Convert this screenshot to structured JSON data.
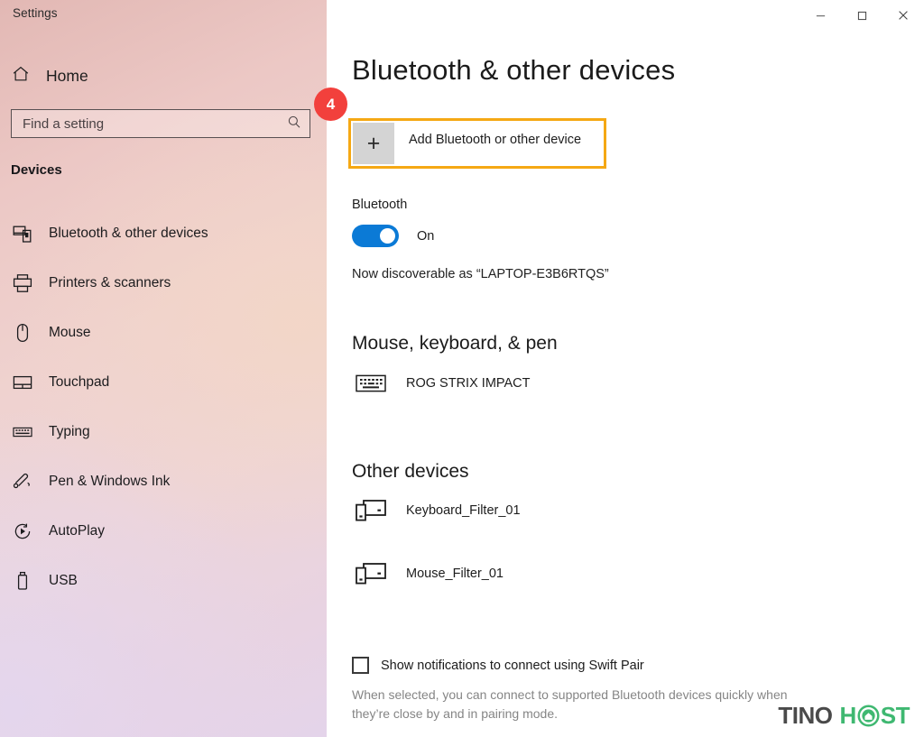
{
  "window": {
    "title": "Settings",
    "controls": [
      {
        "name": "minimize",
        "glyph": "—"
      },
      {
        "name": "maximize",
        "glyph": "□"
      },
      {
        "name": "close",
        "glyph": "✕"
      }
    ]
  },
  "sidebar": {
    "home_label": "Home",
    "search": {
      "placeholder": "Find a setting",
      "value": "",
      "icon": "search-icon"
    },
    "section_header": "Devices",
    "items": [
      {
        "label": "Bluetooth & other devices",
        "icon": "bluetooth-devices-icon",
        "selected": true
      },
      {
        "label": "Printers & scanners",
        "icon": "printer-icon",
        "selected": false
      },
      {
        "label": "Mouse",
        "icon": "mouse-icon",
        "selected": false
      },
      {
        "label": "Touchpad",
        "icon": "touchpad-icon",
        "selected": false
      },
      {
        "label": "Typing",
        "icon": "typing-keyboard-icon",
        "selected": false
      },
      {
        "label": "Pen & Windows Ink",
        "icon": "pen-icon",
        "selected": false
      },
      {
        "label": "AutoPlay",
        "icon": "autoplay-icon",
        "selected": false
      },
      {
        "label": "USB",
        "icon": "usb-icon",
        "selected": false
      }
    ]
  },
  "main": {
    "page_title": "Bluetooth & other devices",
    "step_badge": "4",
    "add_device": {
      "label": "Add Bluetooth or other device",
      "plus_glyph": "+",
      "highlight_color": "#f5a814"
    },
    "bluetooth": {
      "label": "Bluetooth",
      "state": "On",
      "toggle_on": true,
      "toggle_color": "#0b7ad6",
      "discoverable": "Now discoverable as “LAPTOP-E3B6RTQS”"
    },
    "groups": [
      {
        "title": "Mouse, keyboard, & pen",
        "devices": [
          {
            "label": "ROG STRIX IMPACT",
            "icon": "keyboard-icon"
          }
        ]
      },
      {
        "title": "Other devices",
        "devices": [
          {
            "label": "Keyboard_Filter_01",
            "icon": "devices-icon"
          },
          {
            "label": "Mouse_Filter_01",
            "icon": "devices-icon"
          }
        ]
      }
    ],
    "swift_pair": {
      "label": "Show notifications to connect using Swift Pair",
      "checked": false,
      "description": "When selected, you can connect to supported Bluetooth devices quickly when they’re close by and in pairing mode."
    }
  },
  "watermark": {
    "part1": "TINO",
    "part2": "H",
    "part3": "ST",
    "color1": "#4a4a4a",
    "color2": "#3fb871"
  }
}
